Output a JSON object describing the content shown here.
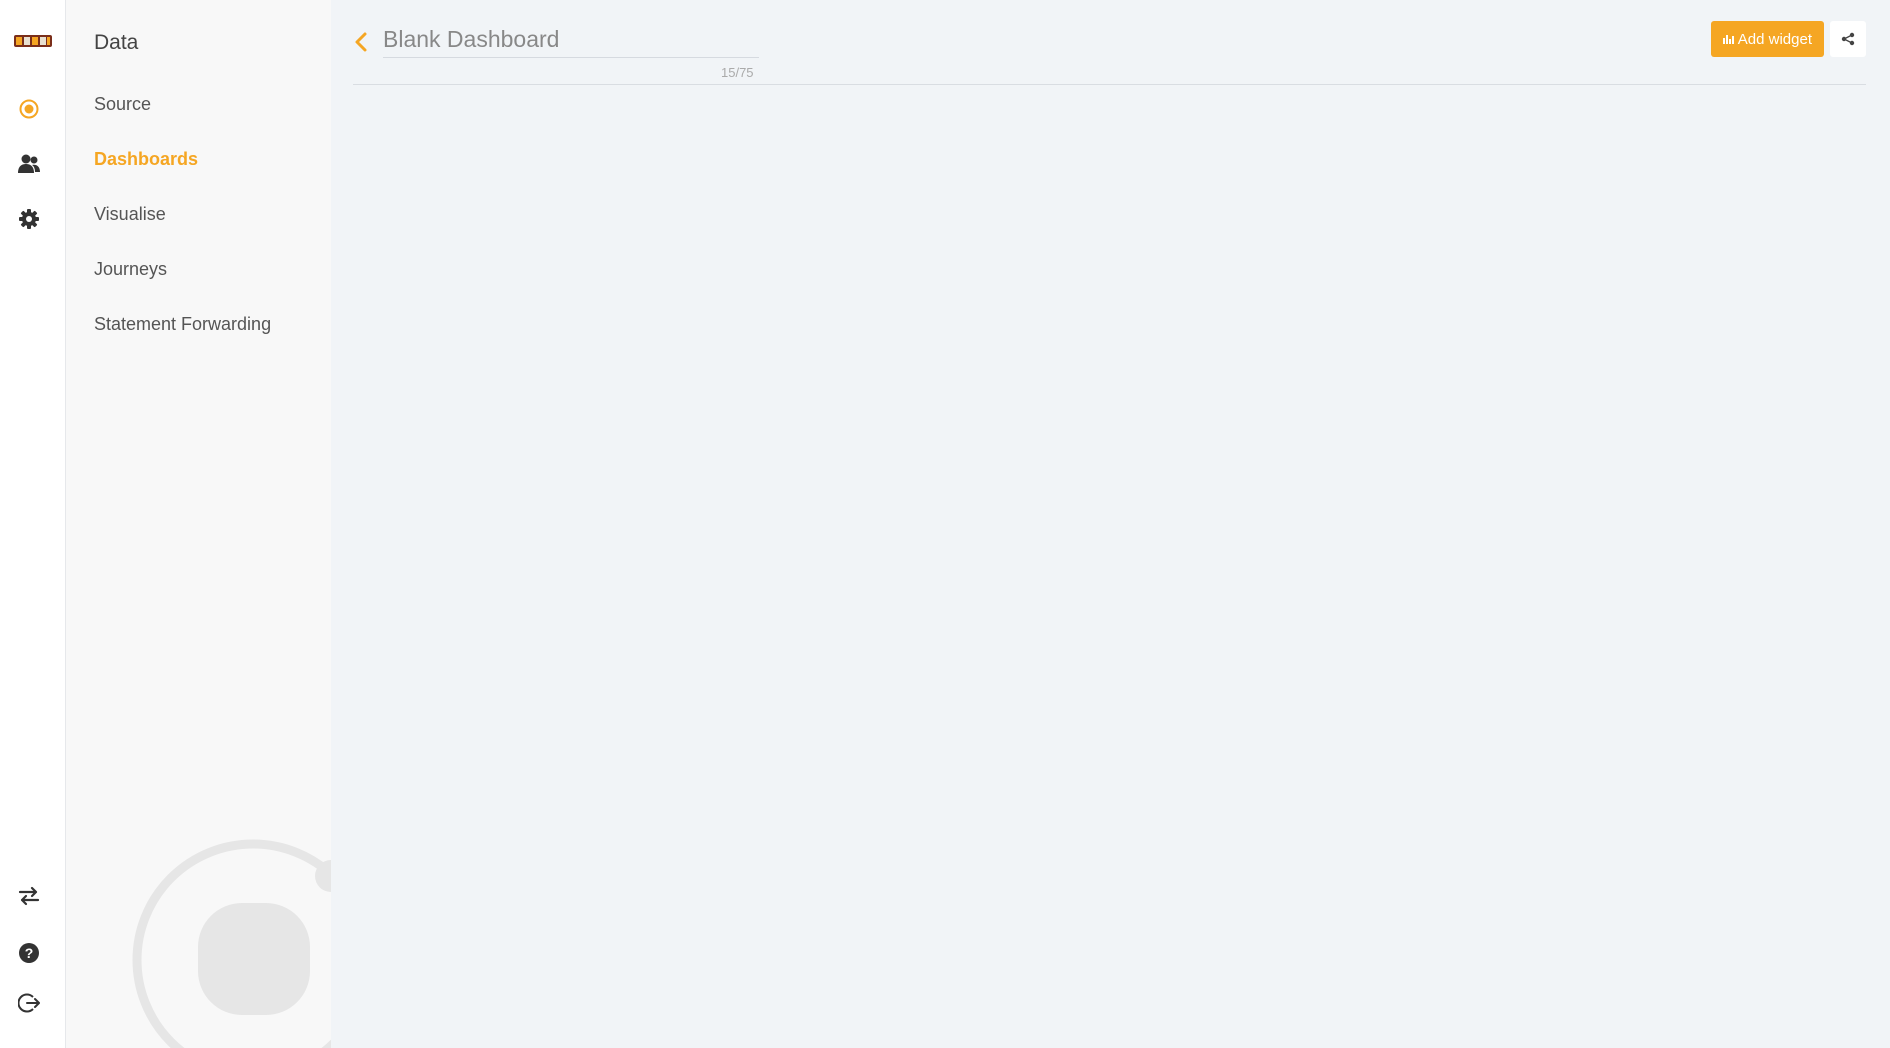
{
  "colors": {
    "accent": "#f5a623",
    "rail_bg": "#ffffff",
    "subnav_bg": "#f8f8f8",
    "main_bg": "#f1f4f7"
  },
  "rail": {
    "logo": "ll-logo",
    "top_icons": [
      "data-target-icon",
      "people-icon",
      "gear-icon"
    ],
    "bottom_icons": [
      "switch-arrows-icon",
      "help-icon",
      "logout-icon"
    ]
  },
  "subnav": {
    "title": "Data",
    "items": [
      {
        "label": "Source",
        "active": false
      },
      {
        "label": "Dashboards",
        "active": true
      },
      {
        "label": "Visualise",
        "active": false
      },
      {
        "label": "Journeys",
        "active": false
      },
      {
        "label": "Statement Forwarding",
        "active": false
      }
    ]
  },
  "main": {
    "back_icon": "chevron-left-icon",
    "dashboard_title": "Blank Dashboard",
    "char_count": "15/75",
    "add_widget_label": "Add widget",
    "add_widget_icon": "bar-chart-icon",
    "share_icon": "share-icon"
  }
}
